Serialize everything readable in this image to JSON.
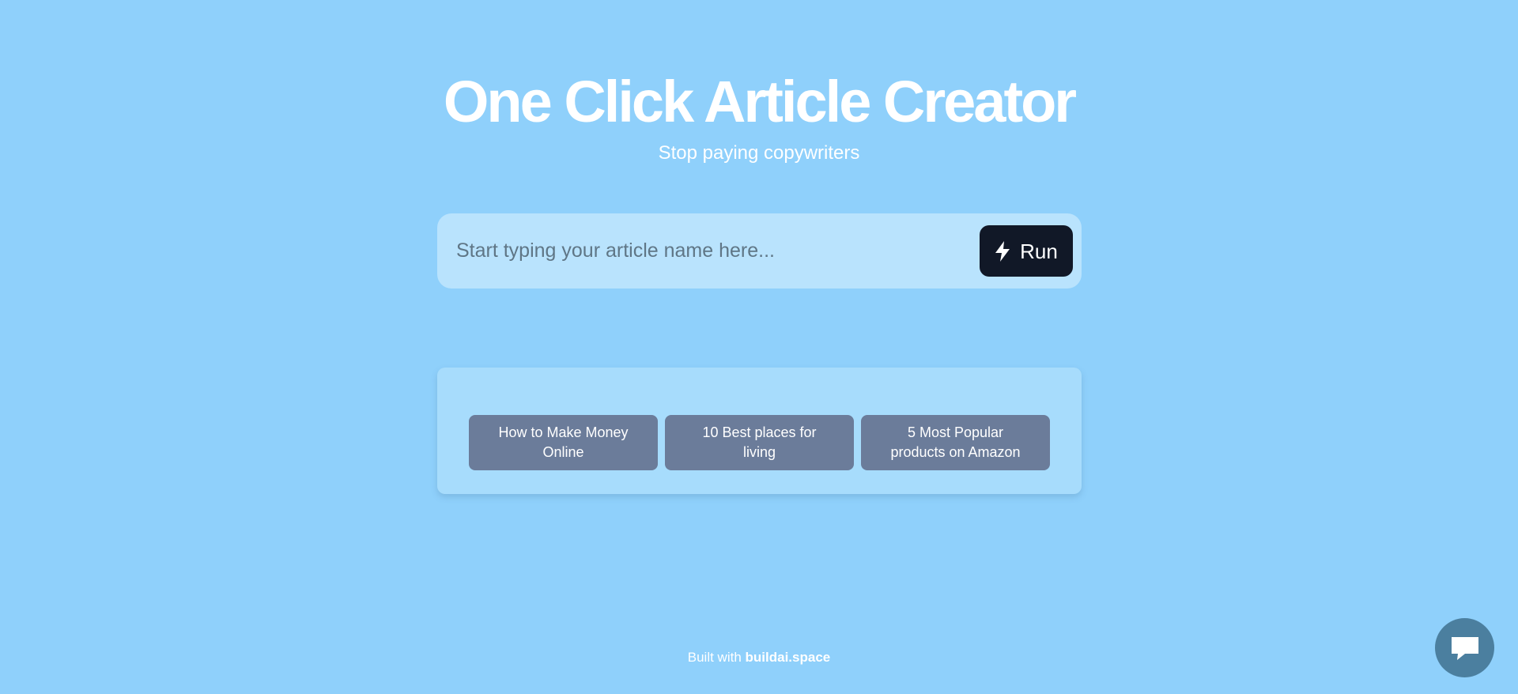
{
  "hero": {
    "title": "One Click Article Creator",
    "subtitle": "Stop paying copywriters"
  },
  "search": {
    "placeholder": "Start typing your article name here...",
    "value": "",
    "run_label": "Run",
    "run_icon": "lightning-bolt-icon"
  },
  "suggestions": [
    {
      "label": "How to Make Money Online"
    },
    {
      "label": "10 Best places for living"
    },
    {
      "label": "5 Most Popular products on Amazon"
    }
  ],
  "footer": {
    "prefix": "Built with",
    "link_label": "buildai.space"
  },
  "chat": {
    "icon": "chat-bubble-icon"
  },
  "colors": {
    "background": "#8fd0fb",
    "search_bar": "#b9e3fd",
    "run_button": "#111827",
    "suggestion": "#6b7c9a",
    "chat_button": "#4b7f9f"
  }
}
